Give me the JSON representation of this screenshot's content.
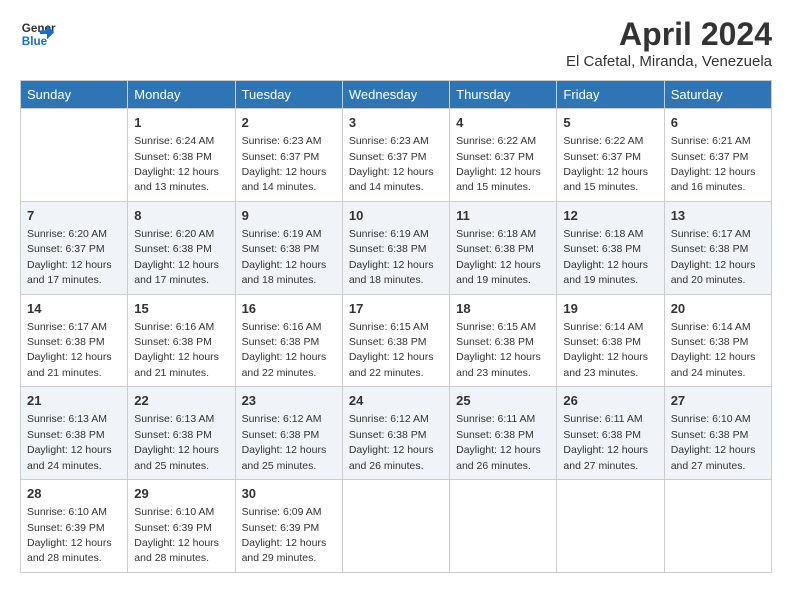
{
  "logo": {
    "line1": "General",
    "line2": "Blue"
  },
  "title": "April 2024",
  "subtitle": "El Cafetal, Miranda, Venezuela",
  "days_of_week": [
    "Sunday",
    "Monday",
    "Tuesday",
    "Wednesday",
    "Thursday",
    "Friday",
    "Saturday"
  ],
  "weeks": [
    [
      {
        "day": "",
        "sunrise": "",
        "sunset": "",
        "daylight": ""
      },
      {
        "day": "1",
        "sunrise": "Sunrise: 6:24 AM",
        "sunset": "Sunset: 6:38 PM",
        "daylight": "Daylight: 12 hours and 13 minutes."
      },
      {
        "day": "2",
        "sunrise": "Sunrise: 6:23 AM",
        "sunset": "Sunset: 6:37 PM",
        "daylight": "Daylight: 12 hours and 14 minutes."
      },
      {
        "day": "3",
        "sunrise": "Sunrise: 6:23 AM",
        "sunset": "Sunset: 6:37 PM",
        "daylight": "Daylight: 12 hours and 14 minutes."
      },
      {
        "day": "4",
        "sunrise": "Sunrise: 6:22 AM",
        "sunset": "Sunset: 6:37 PM",
        "daylight": "Daylight: 12 hours and 15 minutes."
      },
      {
        "day": "5",
        "sunrise": "Sunrise: 6:22 AM",
        "sunset": "Sunset: 6:37 PM",
        "daylight": "Daylight: 12 hours and 15 minutes."
      },
      {
        "day": "6",
        "sunrise": "Sunrise: 6:21 AM",
        "sunset": "Sunset: 6:37 PM",
        "daylight": "Daylight: 12 hours and 16 minutes."
      }
    ],
    [
      {
        "day": "7",
        "sunrise": "Sunrise: 6:20 AM",
        "sunset": "Sunset: 6:37 PM",
        "daylight": "Daylight: 12 hours and 17 minutes."
      },
      {
        "day": "8",
        "sunrise": "Sunrise: 6:20 AM",
        "sunset": "Sunset: 6:38 PM",
        "daylight": "Daylight: 12 hours and 17 minutes."
      },
      {
        "day": "9",
        "sunrise": "Sunrise: 6:19 AM",
        "sunset": "Sunset: 6:38 PM",
        "daylight": "Daylight: 12 hours and 18 minutes."
      },
      {
        "day": "10",
        "sunrise": "Sunrise: 6:19 AM",
        "sunset": "Sunset: 6:38 PM",
        "daylight": "Daylight: 12 hours and 18 minutes."
      },
      {
        "day": "11",
        "sunrise": "Sunrise: 6:18 AM",
        "sunset": "Sunset: 6:38 PM",
        "daylight": "Daylight: 12 hours and 19 minutes."
      },
      {
        "day": "12",
        "sunrise": "Sunrise: 6:18 AM",
        "sunset": "Sunset: 6:38 PM",
        "daylight": "Daylight: 12 hours and 19 minutes."
      },
      {
        "day": "13",
        "sunrise": "Sunrise: 6:17 AM",
        "sunset": "Sunset: 6:38 PM",
        "daylight": "Daylight: 12 hours and 20 minutes."
      }
    ],
    [
      {
        "day": "14",
        "sunrise": "Sunrise: 6:17 AM",
        "sunset": "Sunset: 6:38 PM",
        "daylight": "Daylight: 12 hours and 21 minutes."
      },
      {
        "day": "15",
        "sunrise": "Sunrise: 6:16 AM",
        "sunset": "Sunset: 6:38 PM",
        "daylight": "Daylight: 12 hours and 21 minutes."
      },
      {
        "day": "16",
        "sunrise": "Sunrise: 6:16 AM",
        "sunset": "Sunset: 6:38 PM",
        "daylight": "Daylight: 12 hours and 22 minutes."
      },
      {
        "day": "17",
        "sunrise": "Sunrise: 6:15 AM",
        "sunset": "Sunset: 6:38 PM",
        "daylight": "Daylight: 12 hours and 22 minutes."
      },
      {
        "day": "18",
        "sunrise": "Sunrise: 6:15 AM",
        "sunset": "Sunset: 6:38 PM",
        "daylight": "Daylight: 12 hours and 23 minutes."
      },
      {
        "day": "19",
        "sunrise": "Sunrise: 6:14 AM",
        "sunset": "Sunset: 6:38 PM",
        "daylight": "Daylight: 12 hours and 23 minutes."
      },
      {
        "day": "20",
        "sunrise": "Sunrise: 6:14 AM",
        "sunset": "Sunset: 6:38 PM",
        "daylight": "Daylight: 12 hours and 24 minutes."
      }
    ],
    [
      {
        "day": "21",
        "sunrise": "Sunrise: 6:13 AM",
        "sunset": "Sunset: 6:38 PM",
        "daylight": "Daylight: 12 hours and 24 minutes."
      },
      {
        "day": "22",
        "sunrise": "Sunrise: 6:13 AM",
        "sunset": "Sunset: 6:38 PM",
        "daylight": "Daylight: 12 hours and 25 minutes."
      },
      {
        "day": "23",
        "sunrise": "Sunrise: 6:12 AM",
        "sunset": "Sunset: 6:38 PM",
        "daylight": "Daylight: 12 hours and 25 minutes."
      },
      {
        "day": "24",
        "sunrise": "Sunrise: 6:12 AM",
        "sunset": "Sunset: 6:38 PM",
        "daylight": "Daylight: 12 hours and 26 minutes."
      },
      {
        "day": "25",
        "sunrise": "Sunrise: 6:11 AM",
        "sunset": "Sunset: 6:38 PM",
        "daylight": "Daylight: 12 hours and 26 minutes."
      },
      {
        "day": "26",
        "sunrise": "Sunrise: 6:11 AM",
        "sunset": "Sunset: 6:38 PM",
        "daylight": "Daylight: 12 hours and 27 minutes."
      },
      {
        "day": "27",
        "sunrise": "Sunrise: 6:10 AM",
        "sunset": "Sunset: 6:38 PM",
        "daylight": "Daylight: 12 hours and 27 minutes."
      }
    ],
    [
      {
        "day": "28",
        "sunrise": "Sunrise: 6:10 AM",
        "sunset": "Sunset: 6:39 PM",
        "daylight": "Daylight: 12 hours and 28 minutes."
      },
      {
        "day": "29",
        "sunrise": "Sunrise: 6:10 AM",
        "sunset": "Sunset: 6:39 PM",
        "daylight": "Daylight: 12 hours and 28 minutes."
      },
      {
        "day": "30",
        "sunrise": "Sunrise: 6:09 AM",
        "sunset": "Sunset: 6:39 PM",
        "daylight": "Daylight: 12 hours and 29 minutes."
      },
      {
        "day": "",
        "sunrise": "",
        "sunset": "",
        "daylight": ""
      },
      {
        "day": "",
        "sunrise": "",
        "sunset": "",
        "daylight": ""
      },
      {
        "day": "",
        "sunrise": "",
        "sunset": "",
        "daylight": ""
      },
      {
        "day": "",
        "sunrise": "",
        "sunset": "",
        "daylight": ""
      }
    ]
  ]
}
